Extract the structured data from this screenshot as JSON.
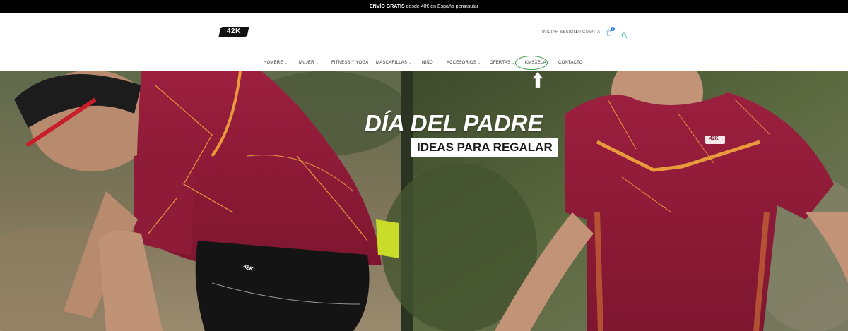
{
  "topbar": {
    "bold_text": "ENVÍO GRATIS",
    "text": " desde 40€ en España peninsular"
  },
  "header": {
    "logo_text": "42K",
    "login_label": "INICIAR SESIÓN",
    "account_label": "MI CUENTA",
    "cart_count": "0",
    "cart_icon": "cart-icon",
    "search_icon": "search-icon"
  },
  "nav": {
    "items": [
      {
        "label": "HOMBRE",
        "has_dropdown": true
      },
      {
        "label": "MUJER",
        "has_dropdown": true
      },
      {
        "label": "FITNESS Y YOGA",
        "has_dropdown": false
      },
      {
        "label": "MASCARILLAS",
        "has_dropdown": true
      },
      {
        "label": "NIÑO",
        "has_dropdown": false
      },
      {
        "label": "ACCESORIOS",
        "has_dropdown": true
      },
      {
        "label": "OFERTAS",
        "has_dropdown": true
      },
      {
        "label": "KMSXELA",
        "has_dropdown": false
      },
      {
        "label": "CONTACTO",
        "has_dropdown": false
      }
    ],
    "chevron": "⌄"
  },
  "hero": {
    "title": "DÍA DEL PADRE",
    "subtitle": "IDEAS PARA REGALAR",
    "shorts_logo": "42K",
    "shirt_logo": "42K"
  },
  "annotation": {
    "highlight_color": "#2e9a3a",
    "arrow_color": "#ffffff"
  }
}
